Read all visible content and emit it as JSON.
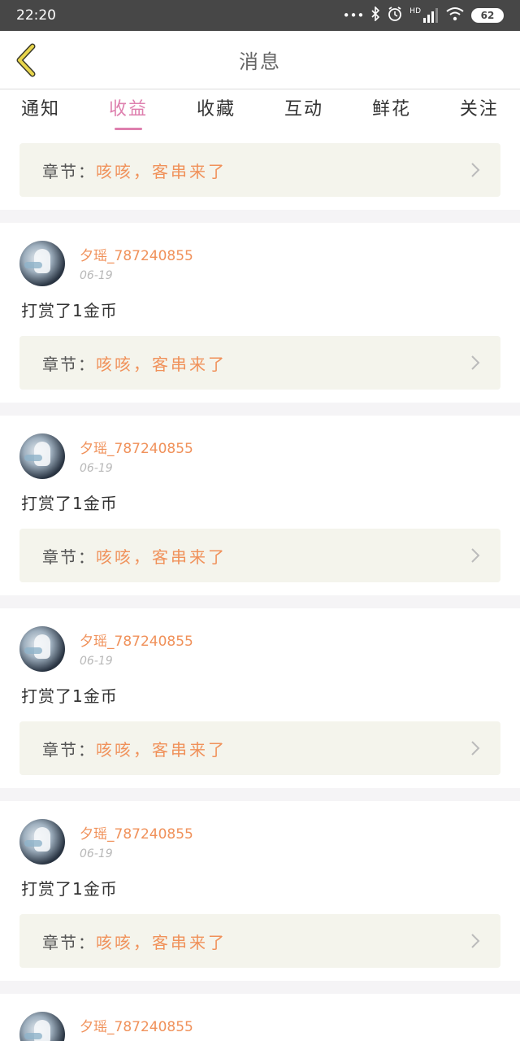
{
  "status": {
    "time": "22:20",
    "battery": "62",
    "dots": "•••",
    "hd": "HD"
  },
  "header": {
    "title": "消息"
  },
  "tabs": [
    {
      "label": "通知"
    },
    {
      "label": "收益"
    },
    {
      "label": "收藏"
    },
    {
      "label": "互动"
    },
    {
      "label": "鲜花"
    },
    {
      "label": "关注"
    }
  ],
  "top_chapter": {
    "label": "章节：",
    "title": "咳咳，客串来了"
  },
  "items": [
    {
      "username": "夕瑶_787240855",
      "date": "06-19",
      "text": "打赏了1金币",
      "chapter_label": "章节：",
      "chapter_title": "咳咳，客串来了"
    },
    {
      "username": "夕瑶_787240855",
      "date": "06-19",
      "text": "打赏了1金币",
      "chapter_label": "章节：",
      "chapter_title": "咳咳，客串来了"
    },
    {
      "username": "夕瑶_787240855",
      "date": "06-19",
      "text": "打赏了1金币",
      "chapter_label": "章节：",
      "chapter_title": "咳咳，客串来了"
    },
    {
      "username": "夕瑶_787240855",
      "date": "06-19",
      "text": "打赏了1金币",
      "chapter_label": "章节：",
      "chapter_title": "咳咳，客串来了"
    },
    {
      "username": "夕瑶_787240855"
    }
  ],
  "colors": {
    "accent": "#de7fae",
    "username": "#f0915a",
    "chapter_bg": "#f4f4ec",
    "back_arrow": "#e8d54c"
  }
}
